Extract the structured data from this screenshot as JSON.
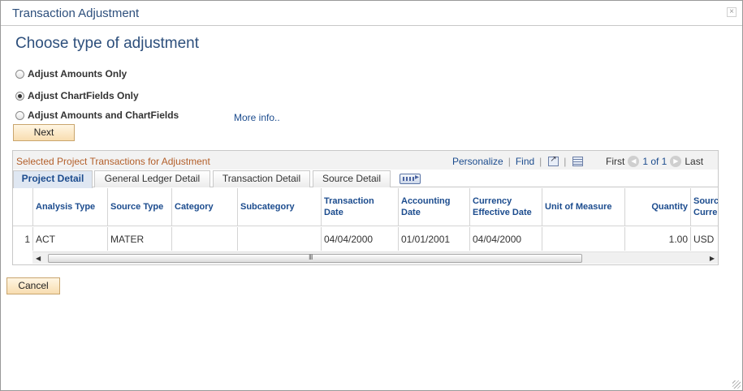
{
  "window": {
    "title": "Transaction Adjustment",
    "close_glyph": "×"
  },
  "page": {
    "heading": "Choose type of adjustment"
  },
  "options": [
    {
      "label": "Adjust Amounts Only",
      "checked": false
    },
    {
      "label": "Adjust ChartFields Only",
      "checked": true
    },
    {
      "label": "Adjust Amounts and ChartFields",
      "checked": false
    }
  ],
  "more_info": "More info..",
  "buttons": {
    "next": "Next",
    "cancel": "Cancel"
  },
  "grid": {
    "title": "Selected Project Transactions for Adjustment",
    "personalize": "Personalize",
    "find": "Find",
    "pager": {
      "first": "First",
      "count": "1 of 1",
      "last": "Last"
    },
    "tabs": [
      {
        "label": "Project Detail",
        "active": true
      },
      {
        "label": "General Ledger Detail",
        "active": false
      },
      {
        "label": "Transaction Detail",
        "active": false
      },
      {
        "label": "Source Detail",
        "active": false
      }
    ],
    "columns": [
      "Analysis Type",
      "Source Type",
      "Category",
      "Subcategory",
      "Transaction Date",
      "Accounting Date",
      "Currency Effective Date",
      "Unit of Measure",
      "Quantity",
      "Source Curre"
    ],
    "rows": [
      {
        "row_num": "1",
        "cells": [
          "ACT",
          "MATER",
          "",
          "",
          "04/04/2000",
          "01/01/2001",
          "04/04/2000",
          "",
          "1.00",
          "USD"
        ]
      }
    ],
    "scroll_grip": "III"
  },
  "icons": {
    "popout": "popout-icon",
    "download": "spreadsheet-icon",
    "prev": "previous-arrow-icon",
    "next": "next-arrow-icon",
    "show_all_columns": "show-all-columns-icon"
  },
  "colors": {
    "accent": "#1c4c8e",
    "title": "#2d4f7c",
    "grid_title": "#b35f2a",
    "button": "#f8ddb0"
  }
}
